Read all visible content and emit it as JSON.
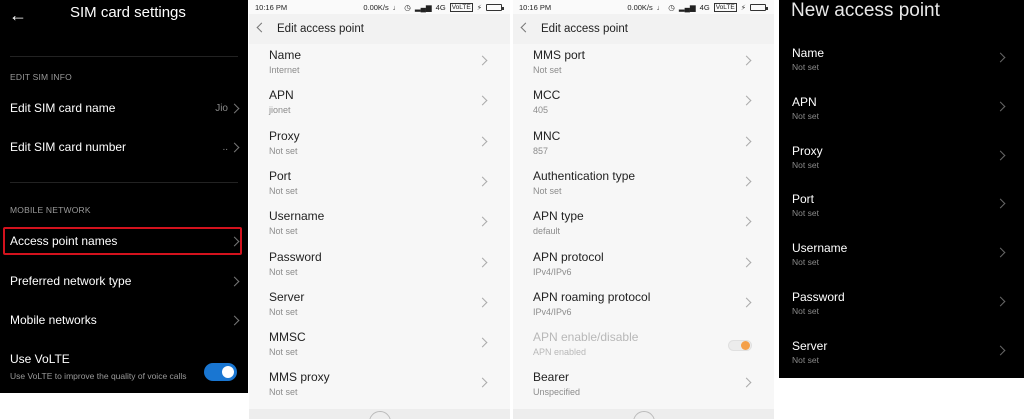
{
  "sim_settings": {
    "back_icon": "arrow-left-icon",
    "title": "SIM card settings",
    "section_edit": "EDIT SIM INFO",
    "edit_name": {
      "label": "Edit SIM card name",
      "value": "Jio"
    },
    "edit_number": {
      "label": "Edit SIM card number",
      "value": ".."
    },
    "section_mobile": "MOBILE NETWORK",
    "apn": {
      "label": "Access point names"
    },
    "preferred": {
      "label": "Preferred network type"
    },
    "mobile_networks": {
      "label": "Mobile networks"
    },
    "volte": {
      "label": "Use VoLTE",
      "sub": "Use VoLTE to improve the quality of voice calls",
      "enabled": true
    },
    "highlight_color": "#d3121d",
    "toggle_color": "#1976d2"
  },
  "status_bar": {
    "time": "10:16 PM",
    "speed": "0.00K/s",
    "network": "4G",
    "volte": "VoLTE"
  },
  "edit_ap_1": {
    "title": "Edit access point",
    "rows": [
      {
        "label": "Name",
        "value": "Internet"
      },
      {
        "label": "APN",
        "value": "jionet"
      },
      {
        "label": "Proxy",
        "value": "Not set"
      },
      {
        "label": "Port",
        "value": "Not set"
      },
      {
        "label": "Username",
        "value": "Not set"
      },
      {
        "label": "Password",
        "value": "Not set"
      },
      {
        "label": "Server",
        "value": "Not set"
      },
      {
        "label": "MMSC",
        "value": "Not set"
      },
      {
        "label": "MMS proxy",
        "value": "Not set"
      }
    ]
  },
  "edit_ap_2": {
    "title": "Edit access point",
    "rows": [
      {
        "label": "MMS port",
        "value": "Not set"
      },
      {
        "label": "MCC",
        "value": "405"
      },
      {
        "label": "MNC",
        "value": "857"
      },
      {
        "label": "Authentication type",
        "value": "Not set"
      },
      {
        "label": "APN type",
        "value": "default"
      },
      {
        "label": "APN protocol",
        "value": "IPv4/IPv6"
      },
      {
        "label": "APN roaming protocol",
        "value": "IPv4/IPv6"
      },
      {
        "label": "APN enable/disable",
        "value": "APN enabled"
      },
      {
        "label": "Bearer",
        "value": "Unspecified"
      }
    ],
    "toggle_color": "#f4a04a"
  },
  "new_ap": {
    "title": "New access point",
    "rows": [
      {
        "label": "Name",
        "value": "Not set"
      },
      {
        "label": "APN",
        "value": "Not set"
      },
      {
        "label": "Proxy",
        "value": "Not set"
      },
      {
        "label": "Port",
        "value": "Not set"
      },
      {
        "label": "Username",
        "value": "Not set"
      },
      {
        "label": "Password",
        "value": "Not set"
      },
      {
        "label": "Server",
        "value": "Not set"
      }
    ]
  }
}
